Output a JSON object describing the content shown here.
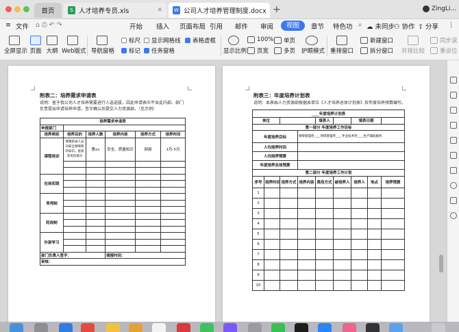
{
  "tabs": [
    {
      "label": "首页",
      "icon": "home"
    },
    {
      "label": "人才培养专员.xls",
      "icon": "spreadsheet"
    },
    {
      "label": "公司人才培养管理制度.docx",
      "icon": "document"
    }
  ],
  "user_name": "ZingLi...",
  "menu": {
    "file": "文件",
    "items": [
      "开始",
      "插入",
      "页面布局",
      "引用",
      "邮件",
      "审阅",
      "视图",
      "章节",
      "特色功"
    ],
    "active": "视图",
    "sync": "未同步",
    "collab": "协作",
    "share": "分享"
  },
  "toolbar": {
    "fullscreen": "全屏显示",
    "page": "页面",
    "outline": "大纲",
    "web": "Web版式",
    "nav": "导航窗格",
    "ruler": "标尺",
    "marks": "标记",
    "gridlines": "显示网格线",
    "taskpane": "任务窗格",
    "tableframe": "表格虚框",
    "zoom_ratio": "显示比例",
    "zoom_100": "100%",
    "page_width": "页宽",
    "single": "单页",
    "multi": "多页",
    "eye": "护眼模式",
    "arrange": "重排窗口",
    "new_window": "新建窗口",
    "split": "拆分窗口",
    "side_by_side": "并排比较",
    "sync_scroll": "同步滚",
    "reset_pos": "重设位"
  },
  "left_page": {
    "title": "附表二：培养需求申请表",
    "desc": "说明：鉴于我公司人才培养需要进行人选选拔，因此申请表中不含此内部、部门负责提出申请培养申请，签字确认后提交人力资源部。（见示例）",
    "table_title": "培养需求申请表",
    "dept_label": "申报部门",
    "headers": [
      "培养类别",
      "培养目的",
      "培养人数",
      "培养内容",
      "培养方式",
      "培养时间"
    ],
    "example": {
      "category": "课程培训",
      "purpose": "保障新录人员对安全保障和的知识，提高其风险意识",
      "count": "第xx",
      "content": "安全、质量知识",
      "method": "网授",
      "time": "1月-5月"
    },
    "categories": [
      "在岗实践",
      "导师制",
      "轮岗制",
      "外部学习"
    ],
    "footer_left": "部门负责人签字：",
    "footer_right": "填报时间：",
    "review": "审核："
  },
  "right_page": {
    "title": "附表三：年度培养计划表",
    "desc": "说明：本表由人力资源部根据本单位《人才培养总体计划表》及年度培养预算编写。",
    "table_title": "____年度培养计划表",
    "unit_label": "单位",
    "filler_label": "填表人",
    "date_label": "填表日期",
    "part1": "第一部分  年度培养工作目标",
    "goal_label": "年度培养目标",
    "goal_text": "保障管理序____项目管理序____专业技术序____生产辅助服务",
    "count_label": "人均培养时间",
    "budget_label": "人均培养预算",
    "arrange_label": "年度培养总体预算",
    "part2": "第二部分  年度培养工作计划",
    "headers": [
      "序号",
      "培养时间",
      "培养方式",
      "培养内容",
      "费用方式",
      "被培养人",
      "培养人",
      "地点",
      "培养预算"
    ],
    "row_numbers": [
      "1",
      "2",
      "3",
      "4",
      "5",
      "6",
      "7",
      "8",
      "9",
      "10"
    ]
  }
}
